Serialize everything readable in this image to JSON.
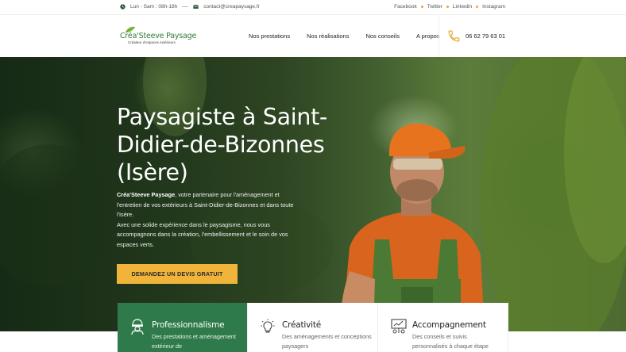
{
  "topbar": {
    "hours": "Lun - Sam : 08h-18h",
    "email": "contact@creapaysage.fr",
    "social": [
      "Facebook",
      "Twitter",
      "Linkedin",
      "Instagram"
    ]
  },
  "header": {
    "logo_name": "Créa'Steeve Paysage",
    "logo_tagline": "Créateur d'espaces extérieurs",
    "nav": [
      "Nos prestations",
      "Nos réalisations",
      "Nos conseils",
      "A propos"
    ],
    "phone": "06 62 79 63 01"
  },
  "hero": {
    "title": "Paysagiste à Saint-Didier-de-Bizonnes (Isère)",
    "desc_strong": "Créa'Steeve Paysage",
    "desc_1": ", votre partenaire pour l'aménagement et l'entretien de vos extérieurs à Saint-Didier-de-Bizonnes et dans toute l'Isère.",
    "desc_2": "Avec une solide expérience dans le paysagisme, nous vous accompagnons dans la création, l'embellissement et le soin de vos espaces verts.",
    "cta": "DEMANDEZ UN DEVIS GRATUIT"
  },
  "features": [
    {
      "title": "Professionnalisme",
      "text": "Des prestations et aménagement extérieur de",
      "icon": "worker-icon"
    },
    {
      "title": "Créativité",
      "text": "Des aménagements et conceptions paysagers",
      "icon": "lightbulb-icon"
    },
    {
      "title": "Accompagnement",
      "text": "Des conseils et suivis personnalisés à chaque étape",
      "icon": "presentation-icon"
    }
  ],
  "colors": {
    "brand_green": "#2f7a4a",
    "accent_yellow": "#f0b43a"
  }
}
